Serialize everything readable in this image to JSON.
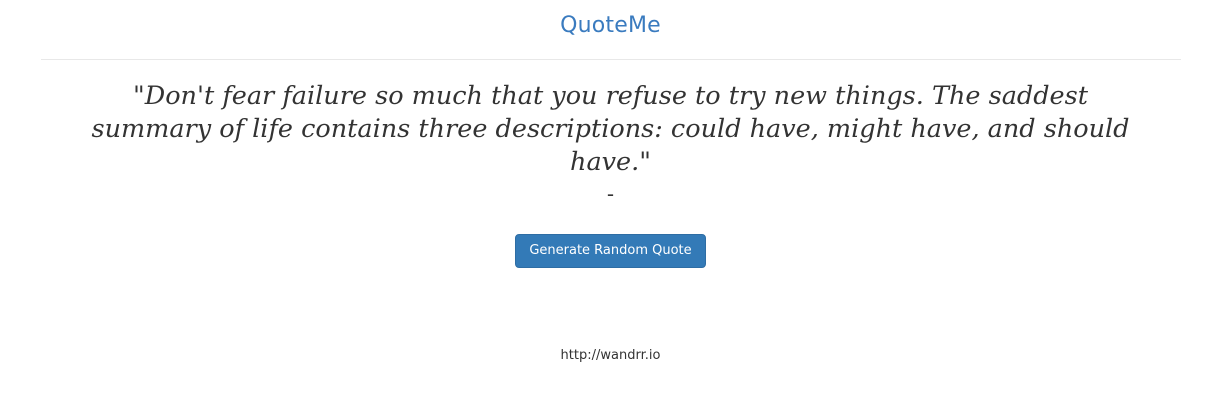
{
  "header": {
    "brand": "QuoteMe"
  },
  "quote": {
    "text": "\"Don't fear failure so much that you refuse to try new things. The saddest summary of life contains three descriptions: could have, might have, and should have.\"",
    "author": "-"
  },
  "actions": {
    "generate_label": "Generate Random Quote"
  },
  "footer": {
    "link": "http://wandrr.io"
  },
  "colors": {
    "brand": "#3a7bbf",
    "button_bg": "#337ab7",
    "text": "#333333",
    "divider": "#e8e8e8"
  }
}
